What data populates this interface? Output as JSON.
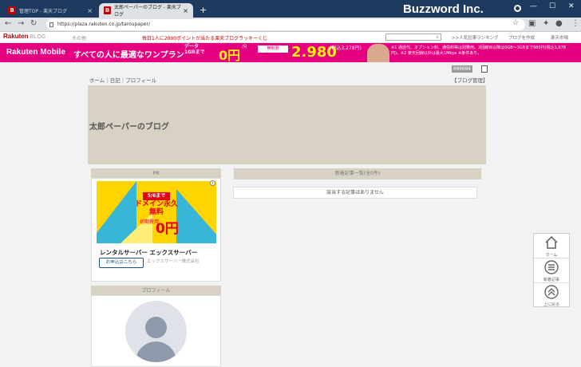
{
  "browser": {
    "tabs": [
      {
        "favicon": "B",
        "title": "管理TOP - 楽天ブログ",
        "close": "×"
      },
      {
        "favicon": "B",
        "title": "太郎ペーパーのブログ - 楽天ブログ",
        "close": "×"
      }
    ],
    "new_tab": "+",
    "brand": "Buzzword Inc.",
    "window_controls": [
      "—",
      "☐",
      "✕"
    ],
    "url": "https://plaza.rakuten.co.jp/taroupaper/"
  },
  "blogbar": {
    "logo": "Rakuten",
    "logo_sub": "BLOG",
    "sonohoka": "その他",
    "promo": "毎日1人に2000ポイントが当たる楽天ブログラッキーくじ",
    "ranking": ">>人気記事ランキング",
    "create": "ブログを作成",
    "member": "楽天市場"
  },
  "ad": {
    "brand": "Rakuten Mobile",
    "headline": "すべての人に最適なワンプラン",
    "data_label": "データ",
    "data_amount": "1GBまで",
    "zero_price": "0円",
    "per_month": "/月",
    "unlimited": "無制限",
    "price": "2.980",
    "price_note": "(税込3,278円)",
    "note": "※1 通話代、オプション料、通信料等は別費用。2回線目以降は0GB～3GBまで980円(税込1,078円)。※2 楽天回線以外は最大1Mbps ※条件あり。"
  },
  "nav": {
    "breadcrumb": "ホーム｜日記｜プロフィール",
    "counter": "000004",
    "blog_admin": "【ブログ管理】"
  },
  "header": {
    "title": "太郎ペーパーのブログ"
  },
  "sidebar": {
    "pr": {
      "heading": "PR",
      "date": "5/6まで",
      "domain": "ドメイン永久無料",
      "first": "初期費用",
      "zero": "0円",
      "name": "レンタルサーバー エックスサーバー",
      "button": "お申込はこちら",
      "company": "エックスサーバー株式会社"
    },
    "profile": {
      "heading": "プロフィール"
    }
  },
  "main": {
    "latest_heading": "新着記事一覧(全0件)",
    "no_entry": "該当する記事はありません"
  },
  "floatnav": [
    {
      "icon": "home-icon",
      "label": "ホーム"
    },
    {
      "icon": "list-icon",
      "label": "新着記事"
    },
    {
      "icon": "up-icon",
      "label": "上に戻る"
    }
  ]
}
